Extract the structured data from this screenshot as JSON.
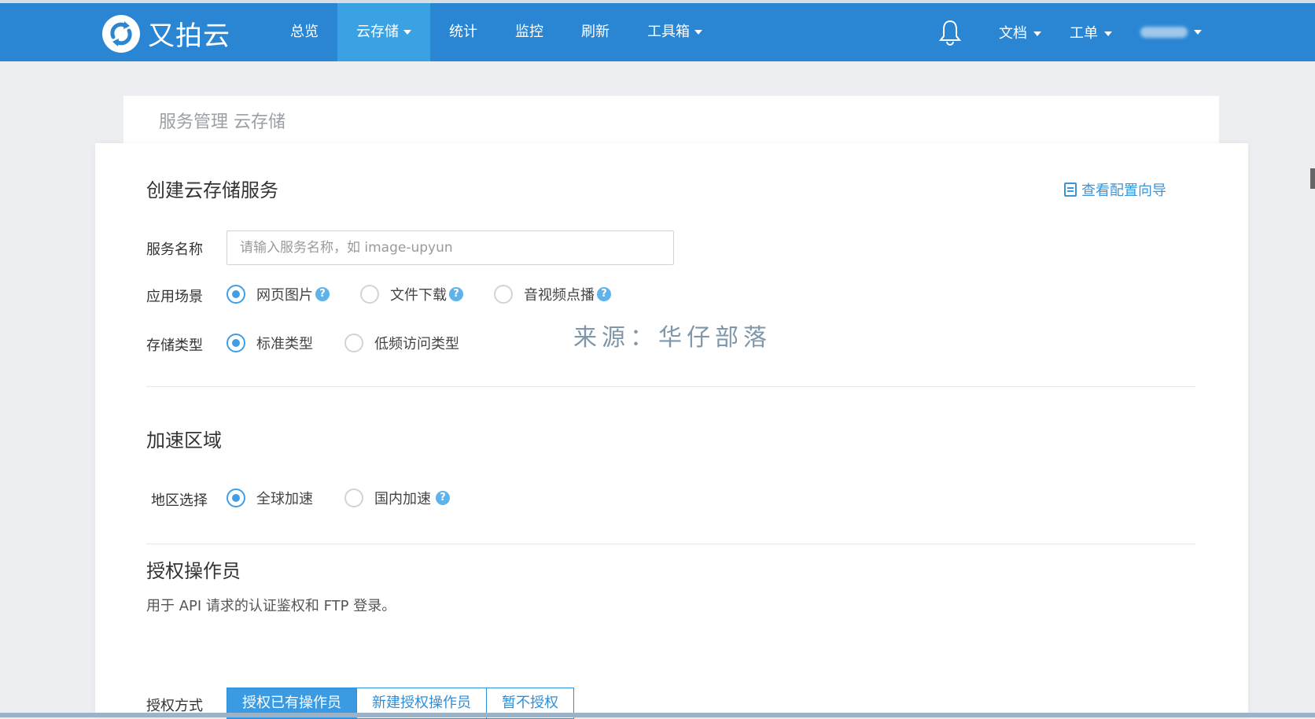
{
  "brand": {
    "name": "又拍云",
    "accent": "#2a86d3",
    "active_tab": "#3aa1e3"
  },
  "nav": {
    "items": [
      {
        "label": "总览",
        "dropdown": false
      },
      {
        "label": "云存储",
        "dropdown": true,
        "active": true
      },
      {
        "label": "统计",
        "dropdown": false
      },
      {
        "label": "监控",
        "dropdown": false
      },
      {
        "label": "刷新",
        "dropdown": false
      },
      {
        "label": "工具箱",
        "dropdown": true
      }
    ],
    "bell_icon": "bell-icon",
    "docs": "文档",
    "tickets": "工单"
  },
  "breadcrumb": "服务管理 云存储",
  "form": {
    "title": "创建云存储服务",
    "guide_link": "查看配置向导",
    "service_name": {
      "label": "服务名称",
      "placeholder": "请输入服务名称，如 image-upyun"
    },
    "scenario": {
      "label": "应用场景",
      "options": [
        "网页图片",
        "文件下载",
        "音视频点播"
      ],
      "selected": "网页图片"
    },
    "storage_type": {
      "label": "存储类型",
      "options": [
        "标准类型",
        "低频访问类型"
      ],
      "selected": "标准类型"
    },
    "watermark": "来源：华仔部落"
  },
  "acceleration": {
    "title": "加速区域",
    "region": {
      "label": "地区选择",
      "options": [
        "全球加速",
        "国内加速"
      ],
      "selected": "全球加速"
    }
  },
  "operator": {
    "title": "授权操作员",
    "description": "用于 API 请求的认证鉴权和 FTP 登录。",
    "method_label": "授权方式",
    "methods": [
      "授权已有操作员",
      "新建授权操作员",
      "暂不授权"
    ],
    "selected": "授权已有操作员"
  }
}
